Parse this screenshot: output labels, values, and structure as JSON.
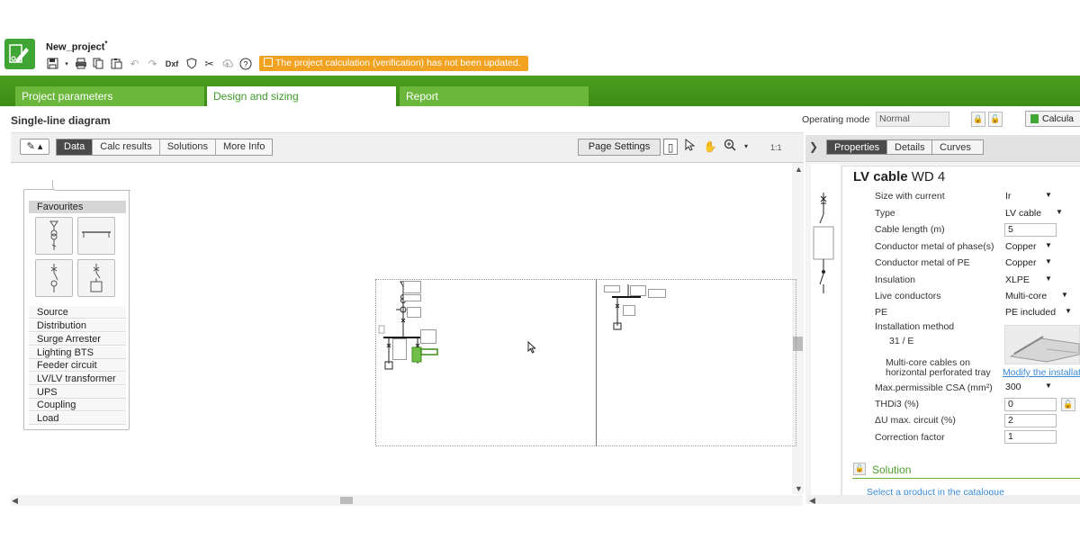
{
  "app": {
    "project_name": "New_project",
    "modified_mark": "*",
    "warning": "The project calculation (verification) has not been updated."
  },
  "toolbar": {
    "icons": [
      "save-icon",
      "print-icon",
      "copy-icon",
      "paste-icon",
      "undo-icon",
      "redo-icon",
      "dxf-icon",
      "shield-icon",
      "tools-icon",
      "upload-icon",
      "help-icon"
    ],
    "dxf_label": "Dxf",
    "help_label": "?"
  },
  "tabs": [
    {
      "label": "Project parameters",
      "active": false
    },
    {
      "label": "Design and sizing",
      "active": true
    },
    {
      "label": "Report",
      "active": false
    }
  ],
  "view": {
    "title": "Single-line diagram",
    "operating_mode_label": "Operating mode",
    "operating_mode_value": "Normal",
    "calculate_label": "Calcula"
  },
  "diagram_toolbar": {
    "pencil_label": "✎ ▴",
    "tabs": [
      "Data",
      "Calc results",
      "Solutions",
      "More Info"
    ],
    "active_tab": "Data",
    "page_settings": "Page Settings",
    "zoom_ratio": "1:1"
  },
  "palette": {
    "favourites_label": "Favourites",
    "categories": [
      "Source",
      "Distribution",
      "Surge Arrester",
      "Lighting BTS",
      "Feeder circuit",
      "LV/LV transformer",
      "UPS",
      "Coupling",
      "Load"
    ]
  },
  "right_panel": {
    "tabs": [
      "Properties",
      "Details",
      "Curves"
    ],
    "active_tab": "Properties",
    "component_type": "LV cable",
    "component_name": "WD 4",
    "properties": [
      {
        "label": "Size with current",
        "value": "Ir",
        "kind": "dropdown"
      },
      {
        "label": "Type",
        "value": "LV cable",
        "kind": "dropdown"
      },
      {
        "label": "Cable length",
        "unit": "(m)",
        "value": "5",
        "kind": "input"
      },
      {
        "label": "Conductor metal of phase(s)",
        "value": "Copper",
        "kind": "dropdown"
      },
      {
        "label": "Conductor metal of PE",
        "value": "Copper",
        "kind": "dropdown"
      },
      {
        "label": "Insulation",
        "value": "XLPE",
        "kind": "dropdown"
      },
      {
        "label": "Live conductors",
        "value": "Multi-core",
        "kind": "dropdown"
      },
      {
        "label": "PE",
        "value": "PE included",
        "kind": "dropdown"
      }
    ],
    "installation": {
      "label": "Installation method",
      "code": "31 / E",
      "description_line1": "Multi-core cables on",
      "description_line2": "horizontal perforated tray",
      "modify_link": "Modify the installati"
    },
    "properties2": [
      {
        "label": "Max.permissible CSA",
        "unit": "(mm²)",
        "value": "300",
        "kind": "dropdown"
      },
      {
        "label": "THDi3",
        "unit": "(%)",
        "value": "0",
        "kind": "input"
      },
      {
        "label": "ΔU max. circuit",
        "unit": "(%)",
        "value": "2",
        "kind": "input"
      },
      {
        "label": "Correction factor",
        "value": "1",
        "kind": "input"
      }
    ],
    "solution_label": "Solution",
    "select_product_link": "Select a product in the catalogue"
  }
}
